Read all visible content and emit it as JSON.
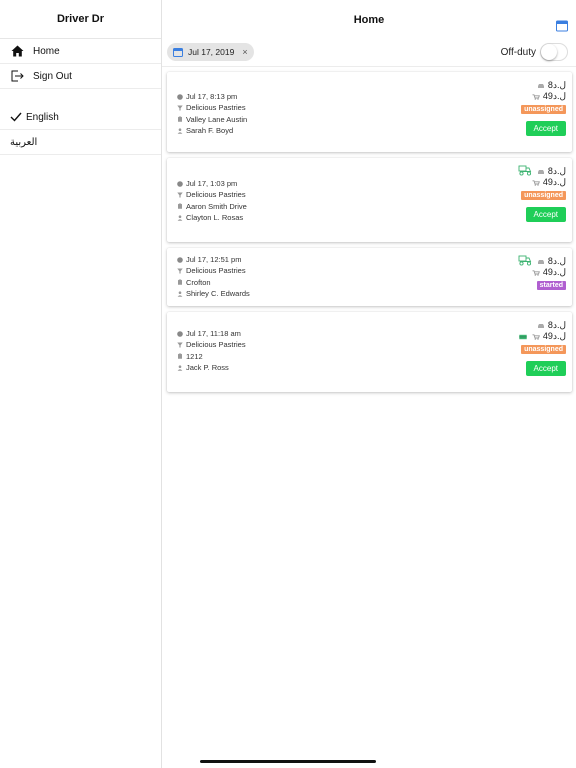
{
  "sidebar": {
    "title": "Driver Dr",
    "items": [
      {
        "label": "Home",
        "icon": "home-icon"
      },
      {
        "label": "Sign Out",
        "icon": "sign-out-icon"
      }
    ],
    "languages": [
      {
        "label": "English",
        "selected": true
      },
      {
        "label": "العربية",
        "selected": false
      }
    ]
  },
  "header": {
    "title": "Home",
    "calendar_icon": "calendar-icon"
  },
  "filter": {
    "date_chip": "Jul 17, 2019",
    "clear": "×",
    "duty_label": "Off-duty",
    "duty_on": false
  },
  "colors": {
    "accent": "#3b7fe0",
    "unassigned": "#f4975a",
    "started": "#b05fd0",
    "accept": "#1fce58",
    "scooter": "#3cb371"
  },
  "orders": [
    {
      "time": "Jul 17, 8:13 pm",
      "store": "Delicious Pastries",
      "address": "Valley Lane Austin",
      "customer": "Sarah F. Boyd",
      "delivery_fee": "8ل.د",
      "total": "49ل.د",
      "status": "unassigned",
      "action": "Accept",
      "scooter": false,
      "cash": false
    },
    {
      "time": "Jul 17, 1:03 pm",
      "store": "Delicious Pastries",
      "address": "Aaron Smith Drive",
      "customer": "Clayton L. Rosas",
      "delivery_fee": "8ل.د",
      "total": "49ل.د",
      "status": "unassigned",
      "action": "Accept",
      "scooter": true,
      "cash": false
    },
    {
      "time": "Jul 17, 12:51 pm",
      "store": "Delicious Pastries",
      "address": "Crofton",
      "customer": "Shirley C. Edwards",
      "delivery_fee": "8ل.د",
      "total": "49ل.د",
      "status": "started",
      "action": "",
      "scooter": true,
      "cash": false
    },
    {
      "time": "Jul 17, 11:18 am",
      "store": "Delicious Pastries",
      "address": "1212",
      "customer": "Jack P. Ross",
      "delivery_fee": "8ل.د",
      "total": "49ل.د",
      "status": "unassigned",
      "action": "Accept",
      "scooter": false,
      "cash": true
    }
  ]
}
